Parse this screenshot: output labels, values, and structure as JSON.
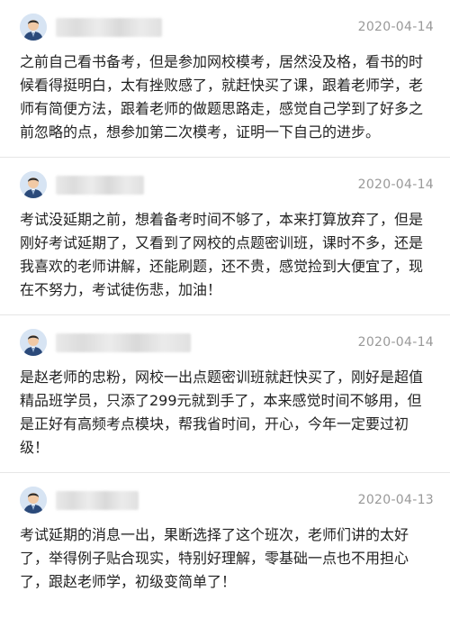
{
  "reviews": [
    {
      "date": "2020-04-14",
      "content": "之前自己看书备考，但是参加网校模考，居然没及格，看书的时候看得挺明白，太有挫败感了，就赶快买了课，跟着老师学，老师有简便方法，跟着老师的做题思路走，感觉自己学到了好多之前忽略的点，想参加第二次模考，证明一下自己的进步。"
    },
    {
      "date": "2020-04-14",
      "content": "考试没延期之前，想着备考时间不够了，本来打算放弃了，但是刚好考试延期了，又看到了网校的点题密训班，课时不多，还是我喜欢的老师讲解，还能刷题，还不贵，感觉捡到大便宜了，现在不努力，考试徒伤悲，加油！"
    },
    {
      "date": "2020-04-14",
      "content": "是赵老师的忠粉，网校一出点题密训班就赶快买了，刚好是超值精品班学员，只添了299元就到手了，本来感觉时间不够用，但是正好有高频考点模块，帮我省时间，开心，今年一定要过初级！"
    },
    {
      "date": "2020-04-13",
      "content": "考试延期的消息一出，果断选择了这个班次，老师们讲的太好了，举得例子贴合现实，特别好理解，零基础一点也不用担心了，跟赵老师学，初级变简单了！"
    }
  ]
}
